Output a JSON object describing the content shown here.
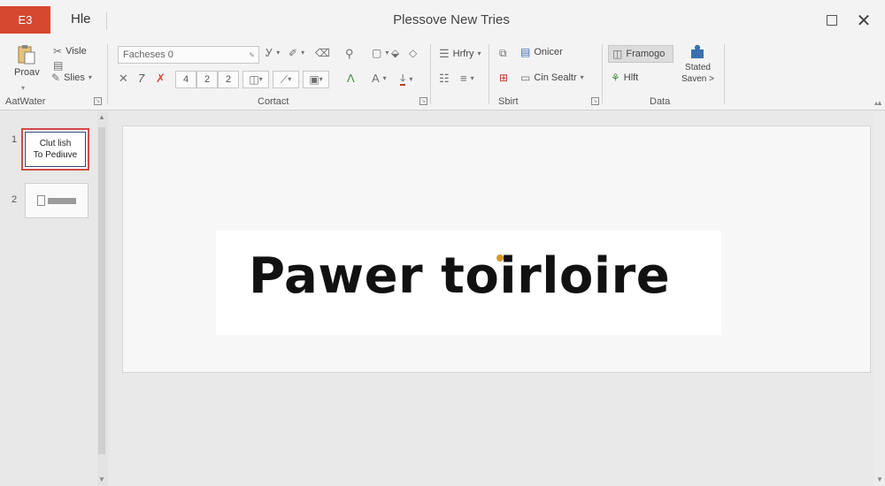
{
  "titlebar": {
    "app_badge": "E3",
    "file_tab": "Hle",
    "title": "Plessove New Tries"
  },
  "ribbon": {
    "groups": {
      "clipboard": "AatWater",
      "font": "Cortact",
      "paragraph": "Sbirt",
      "data": "Data"
    },
    "clipboard": {
      "paste": "Proav",
      "visle": "Visle",
      "slies": "Slies"
    },
    "font": {
      "font_name": "Facheses 0",
      "size_a": "4",
      "size_b": "2",
      "size_c": "2"
    },
    "paragraph": {
      "hrfry": "Hrfry",
      "onicer": "Onicer",
      "cinsealtr": "Cin Sealtr"
    },
    "data": {
      "framego": "Framogo",
      "hlft": "Hlft",
      "stated_line1": "Stated",
      "stated_line2": "Saven >"
    }
  },
  "thumbnails": [
    {
      "number": "1",
      "line1": "Clut lish",
      "line2": "To Pediuve"
    },
    {
      "number": "2"
    }
  ],
  "slide": {
    "title": "Pawer toirloire"
  },
  "icons": {
    "paste": "clipboard-paste-icon",
    "cut": "scissors-icon",
    "format_painter": "brush-icon",
    "find": "search-icon",
    "arrange": "puzzle-icon"
  },
  "colors": {
    "app_accent": "#d64830",
    "selected_thumbnail": "#d14a4a",
    "arrange_icon": "#3a6fb0"
  }
}
